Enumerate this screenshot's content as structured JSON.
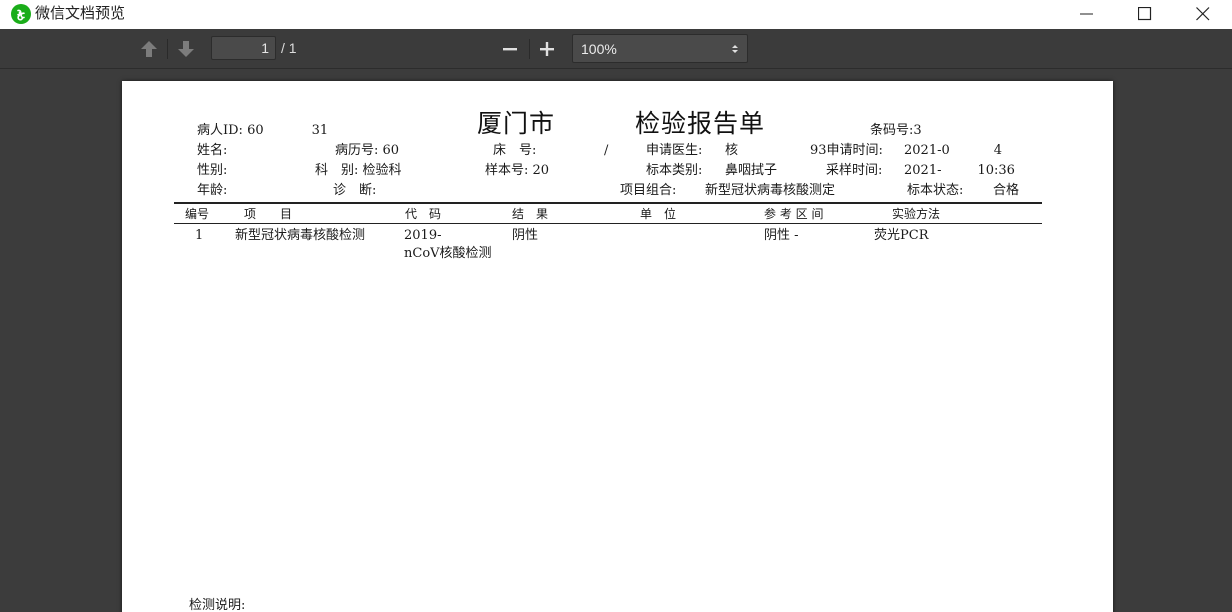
{
  "window": {
    "title": "微信文档预览",
    "controls": {
      "minimize": "minimize-icon",
      "maximize": "maximize-icon",
      "close": "close-icon"
    }
  },
  "toolbar": {
    "current_page": "1",
    "total_pages": "/ 1",
    "zoom": "100%",
    "icons": [
      "up-arrow-icon",
      "down-arrow-icon",
      "minus-icon",
      "plus-icon",
      "select-arrows-icon"
    ]
  },
  "report": {
    "title": "厦门市",
    "title_suffix": "检验报告单",
    "header": {
      "patient_id": "病人ID: 60",
      "patient_id_tail": "31",
      "barcode_label": "条码号:",
      "barcode_tail": "3",
      "name_label": "姓名:",
      "record_label": "病历号: 60",
      "bed_label": "床　号:",
      "bed_value": "/",
      "doctor_label": "申请医生:",
      "doctor_value": "核",
      "apply_time_label": "93申请时间:",
      "apply_time_value": "2021-0",
      "apply_time_tail": "4",
      "sex_label": "性别:",
      "dept_label": "科　别: 检验科",
      "sample_no_label": "样本号: 20",
      "sample_type_label": "标本类别:",
      "sample_type_value": "鼻咽拭子",
      "collect_time_label": "采样时间:",
      "collect_time_value": "2021-",
      "collect_time_tail": "10:36",
      "age_label": "年龄:",
      "diagnosis_label": "诊　断:",
      "combo_label": "项目组合:",
      "combo_value": "新型冠状病毒核酸测定",
      "status_label": "标本状态:",
      "status_value": "合格"
    },
    "columns": [
      "编号",
      "项　　目",
      "代　码",
      "结　果",
      "单　位",
      "参 考 区 间",
      "实验方法"
    ],
    "rows": [
      {
        "no": "1",
        "item": "新型冠状病毒核酸检测",
        "code_line1": "2019-",
        "code_line2": "nCoV核酸检测",
        "result": "阴性",
        "unit": "",
        "reference": "阴性 -",
        "method": "荧光PCR"
      }
    ],
    "footer_label": "检测说明:"
  }
}
